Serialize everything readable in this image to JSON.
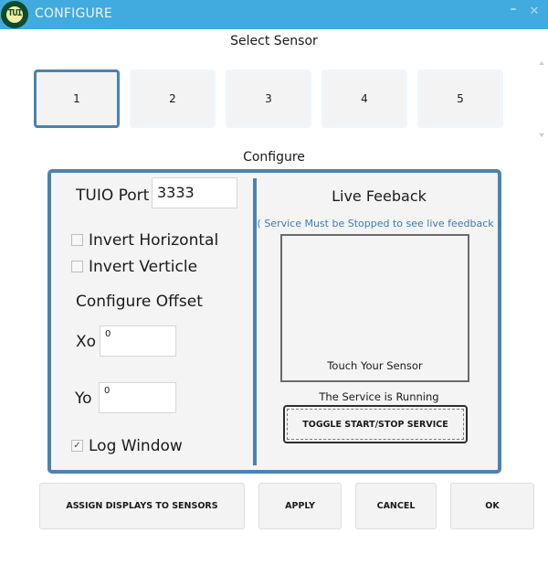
{
  "window": {
    "title": "CONFIGURE",
    "logo_text": "TUI",
    "minimize_glyph": "–",
    "close_glyph": "✕"
  },
  "sensor_select": {
    "label": "Select Sensor",
    "selected": "1",
    "sensors": [
      "1",
      "2",
      "3",
      "4",
      "5"
    ]
  },
  "configure": {
    "label": "Configure",
    "tuio_port_label": "TUIO Port",
    "tuio_port_value": "3333",
    "invert_horizontal": {
      "label": "Invert Horizontal",
      "checked": false
    },
    "invert_verticle": {
      "label": "Invert Verticle",
      "checked": false
    },
    "offset_label": "Configure Offset",
    "xo_label": "Xo",
    "xo_value": "0",
    "yo_label": "Yo",
    "yo_value": "0",
    "log_window": {
      "label": "Log Window",
      "checked": true,
      "check_glyph": "✓"
    }
  },
  "live_feedback": {
    "title": "Live Feeback",
    "note": "( Service Must be Stopped to see live feedback )",
    "touch_prompt": "Touch Your Sensor",
    "service_status": "The Service is Running",
    "toggle_label": "TOGGLE START/STOP SERVICE"
  },
  "buttons": {
    "assign": "ASSIGN DISPLAYS TO SENSORS",
    "apply": "APPLY",
    "cancel": "CANCEL",
    "ok": "OK"
  },
  "colors": {
    "titlebar": "#41abdf",
    "accent_border": "#4a82b4",
    "note_text": "#3d7ab6"
  }
}
